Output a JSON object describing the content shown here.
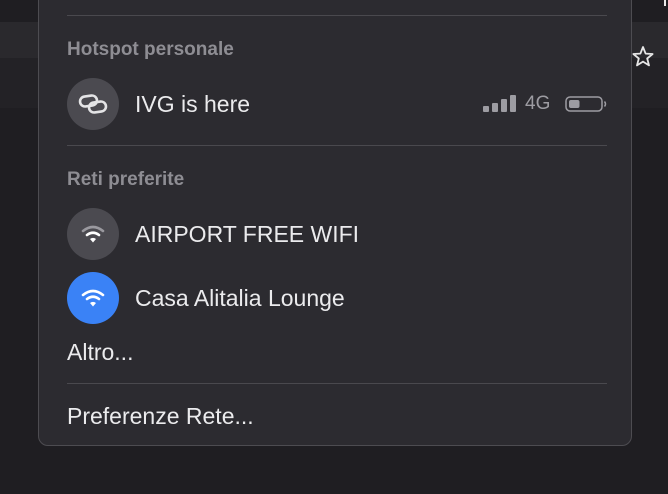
{
  "hotspot": {
    "header": "Hotspot personale",
    "device_name": "IVG is here",
    "signal_bars": 4,
    "network_type": "4G",
    "battery_level": 0.35
  },
  "preferred": {
    "header": "Reti preferite",
    "networks": [
      {
        "name": "AIRPORT FREE WIFI",
        "connected": false
      },
      {
        "name": "Casa Alitalia Lounge",
        "connected": true
      }
    ]
  },
  "other_label": "Altro...",
  "preferences_label": "Preferenze Rete...",
  "icons": {
    "hotspot": "link-icon",
    "wifi": "wifi-icon",
    "battery": "battery-icon",
    "signal": "cellular-signal-icon",
    "bookmark": "star-icon"
  },
  "colors": {
    "menu_background": "#2c2b30",
    "active_accent": "#3a82f6",
    "inactive_icon_bg": "#4b4a50",
    "text_primary": "#ebebed",
    "text_secondary": "#8e8d93"
  }
}
